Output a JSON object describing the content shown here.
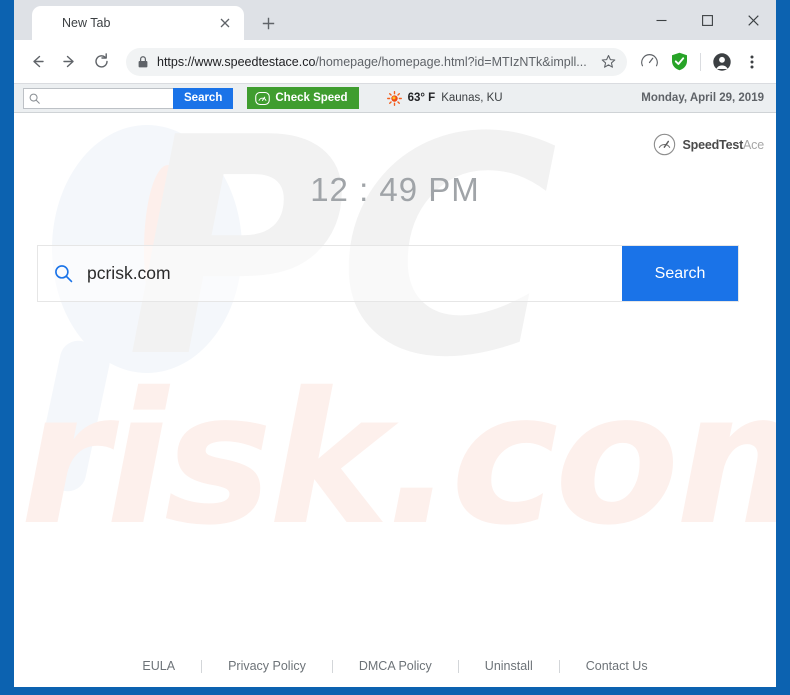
{
  "browser": {
    "tab": {
      "title": "New Tab",
      "close_icon": "close-icon",
      "new_tab_icon": "plus-icon"
    },
    "window_controls": {
      "minimize": "minimize-icon",
      "maximize": "maximize-icon",
      "close": "close-icon"
    },
    "nav": {
      "back_icon": "arrow-left-icon",
      "forward_icon": "arrow-right-icon",
      "reload_icon": "reload-icon",
      "lock_icon": "lock-icon",
      "url_domain": "https://www.speedtestace.co",
      "url_path": "/homepage/homepage.html?id=MTIzNTk&impll...",
      "star_icon": "star-icon",
      "extension_speed_icon": "speedometer-icon",
      "extension_shield_icon": "shield-check-icon",
      "profile_icon": "profile-avatar-icon",
      "menu_icon": "three-dot-menu-icon"
    }
  },
  "ext_toolbar": {
    "search_icon": "search-icon",
    "search_placeholder": "",
    "search_value": "",
    "search_button_label": "Search",
    "check_speed_label": "Check Speed",
    "check_speed_icon": "speedometer-icon",
    "check_speed_color": "#3f9d2f",
    "weather_icon": "sun-icon",
    "weather_temp": "63° F",
    "weather_city": "Kaunas, KU",
    "date": "Monday, April 29, 2019"
  },
  "page": {
    "logo": {
      "icon": "speedometer-icon",
      "name_bold": "SpeedTest",
      "name_light": "Ace"
    },
    "clock": "12 : 49 PM",
    "search": {
      "icon": "search-icon",
      "value": "pcrisk.com",
      "button_label": "Search",
      "button_color": "#1a73e8"
    },
    "watermark": {
      "top_text": "PC",
      "bottom_text": "risk.com"
    },
    "footer_links": [
      {
        "label": "EULA"
      },
      {
        "label": "Privacy Policy"
      },
      {
        "label": "DMCA Policy"
      },
      {
        "label": "Uninstall"
      },
      {
        "label": "Contact Us"
      }
    ]
  }
}
